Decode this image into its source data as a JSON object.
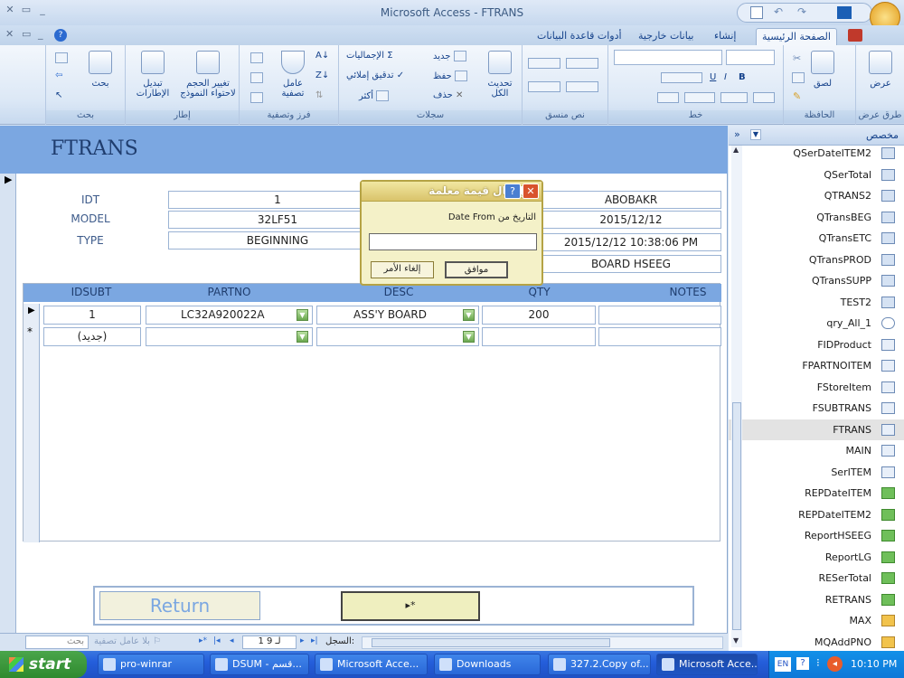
{
  "window": {
    "title": "Microsoft Access - FTRANS"
  },
  "tabs": {
    "home": "الصفحة الرئيسية",
    "create": "إنشاء",
    "external": "بيانات خارجية",
    "dbtools": "أدوات قاعدة البيانات"
  },
  "ribbon": {
    "views": {
      "view": "عرض",
      "group": "طرق عرض"
    },
    "clipboard": {
      "paste": "لصق",
      "group": "الحافظة"
    },
    "font": {
      "group": "خط"
    },
    "richtext": {
      "group": "نص منسق"
    },
    "records": {
      "refresh": "تحديث",
      "refresh2": "الكل",
      "new": "جديد",
      "save": "حفظ",
      "delete": "حذف",
      "totals": "الإجماليات",
      "spelling": "تدقيق إملائي",
      "more": "أكثر",
      "group": "سجلات"
    },
    "sortfilter": {
      "filter": "عامل",
      "filter2": "تصفية",
      "group": "فرز وتصفية"
    },
    "window": {
      "size": "تغيير الحجم",
      "size2": "لاحتواء النموذج",
      "switch": "تبديل",
      "switch2": "الإطارات",
      "group": "إطار"
    },
    "find": {
      "find": "بحث",
      "group": "بحث"
    }
  },
  "form": {
    "title": "FTRANS",
    "labels": {
      "idt": "IDT",
      "model": "MODEL",
      "type": "TYPE"
    },
    "values": {
      "idt": "1",
      "model": "32LF51",
      "type": "BEGINNING",
      "user": "ABOBAKR",
      "date": "2015/12/12",
      "datetime": "2015/12/12 10:38:06 PM",
      "board": "BOARD HSEEG"
    },
    "subform": {
      "columns": [
        "IDSUBT",
        "PARTNO",
        "DESC",
        "QTY",
        "NOTES"
      ],
      "row": {
        "idsubt": "1",
        "partno": "LC32A920022A",
        "desc": "ASS'Y BOARD",
        "qty": "200",
        "notes": ""
      },
      "newrow": {
        "idsubt": "(جديد)"
      }
    },
    "buttons": {
      "return": "Return",
      "new": "▸*"
    }
  },
  "dialog": {
    "title": "إدخال قيمة معلمة",
    "prompt": "Date From التاريخ من",
    "input": "",
    "ok": "موافق",
    "cancel": "إلغاء الأمر"
  },
  "nav": {
    "label": "السجل:",
    "position": "1 لـ 9",
    "nofilter": "بلا عامل تصفية",
    "search": "بحث"
  },
  "navpane": {
    "header": "مخصص",
    "items": [
      {
        "label": "QSerDateITEM2",
        "icon": "query"
      },
      {
        "label": "QSerTotal",
        "icon": "query"
      },
      {
        "label": "QTRANS2",
        "icon": "query"
      },
      {
        "label": "QTransBEG",
        "icon": "query"
      },
      {
        "label": "QTransETC",
        "icon": "query"
      },
      {
        "label": "QTransPROD",
        "icon": "query"
      },
      {
        "label": "QTransSUPP",
        "icon": "query"
      },
      {
        "label": "TEST2",
        "icon": "query"
      },
      {
        "label": "qry_All_1",
        "icon": "union-query"
      },
      {
        "label": "FIDProduct",
        "icon": "form"
      },
      {
        "label": "FPARTNOITEM",
        "icon": "form"
      },
      {
        "label": "FStoreItem",
        "icon": "form"
      },
      {
        "label": "FSUBTRANS",
        "icon": "form"
      },
      {
        "label": "FTRANS",
        "icon": "form"
      },
      {
        "label": "MAIN",
        "icon": "form"
      },
      {
        "label": "SerITEM",
        "icon": "form"
      },
      {
        "label": "REPDateITEM",
        "icon": "report"
      },
      {
        "label": "REPDateITEM2",
        "icon": "report"
      },
      {
        "label": "ReportHSEEG",
        "icon": "report"
      },
      {
        "label": "ReportLG",
        "icon": "report"
      },
      {
        "label": "RESerTotal",
        "icon": "report"
      },
      {
        "label": "RETRANS",
        "icon": "report"
      },
      {
        "label": "MAX",
        "icon": "macro"
      },
      {
        "label": "MQAddPNO",
        "icon": "macro"
      }
    ]
  },
  "taskbar": {
    "start": "start",
    "tasks": [
      "pro-winrar",
      "DSUM - قسم...",
      "Microsoft Acce...",
      "Downloads",
      "327.2.Copy of...",
      "Microsoft Acce..."
    ],
    "lang": "EN",
    "clock": "10:10 PM"
  }
}
